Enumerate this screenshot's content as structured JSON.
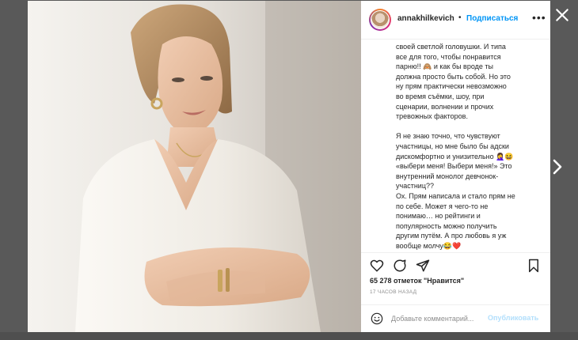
{
  "colors": {
    "accent": "#0095f6",
    "overlay": "#595959",
    "text": "#262626",
    "muted": "#8e8e8e",
    "publish_disabled": "#b2dffc"
  },
  "header": {
    "username": "annakhilkevich",
    "separator": "•",
    "follow_label": "Подписаться",
    "more_icon": "more-horizontal-icon"
  },
  "caption": {
    "text": "своей светлой головушки. И типа\nвсе для того, чтобы понравится\nпарню!! 🙈 и как бы вроде ты\nдолжна просто быть собой. Но это\nну прям практически невозможно\nво время съёмки, шоу, при\nсценарии, волнении и прочих\nтревожных факторов.\n\nЯ не знаю точно, что чувствуют\nучастницы, но мне было бы адски\nдискомфортно и унизительно 🤦‍♀️😆\n«выбери меня! Выбери меня!» Это\nвнутренний монолог девчонок-\nучастниц??\nОх. Прям написала и стало прям не\nпо себе. Может я чего-то не\nпонимаю… но рейтинги и\nпопулярность можно получить\nдругим путём. А про любовь я уж\nвообще молчу😂❤️"
  },
  "actions": {
    "like_icon": "heart-icon",
    "comment_icon": "comment-icon",
    "share_icon": "share-icon",
    "save_icon": "bookmark-icon"
  },
  "likes": {
    "text": "65 278 отметок \"Нравится\""
  },
  "time": {
    "text": "17 ЧАСОВ НАЗАД"
  },
  "comment": {
    "placeholder": "Добавьте комментарий...",
    "publish_label": "Опубликовать",
    "emoji_icon": "emoji-smile-icon"
  },
  "nav": {
    "close_icon": "close-icon",
    "next_icon": "chevron-right-icon"
  }
}
